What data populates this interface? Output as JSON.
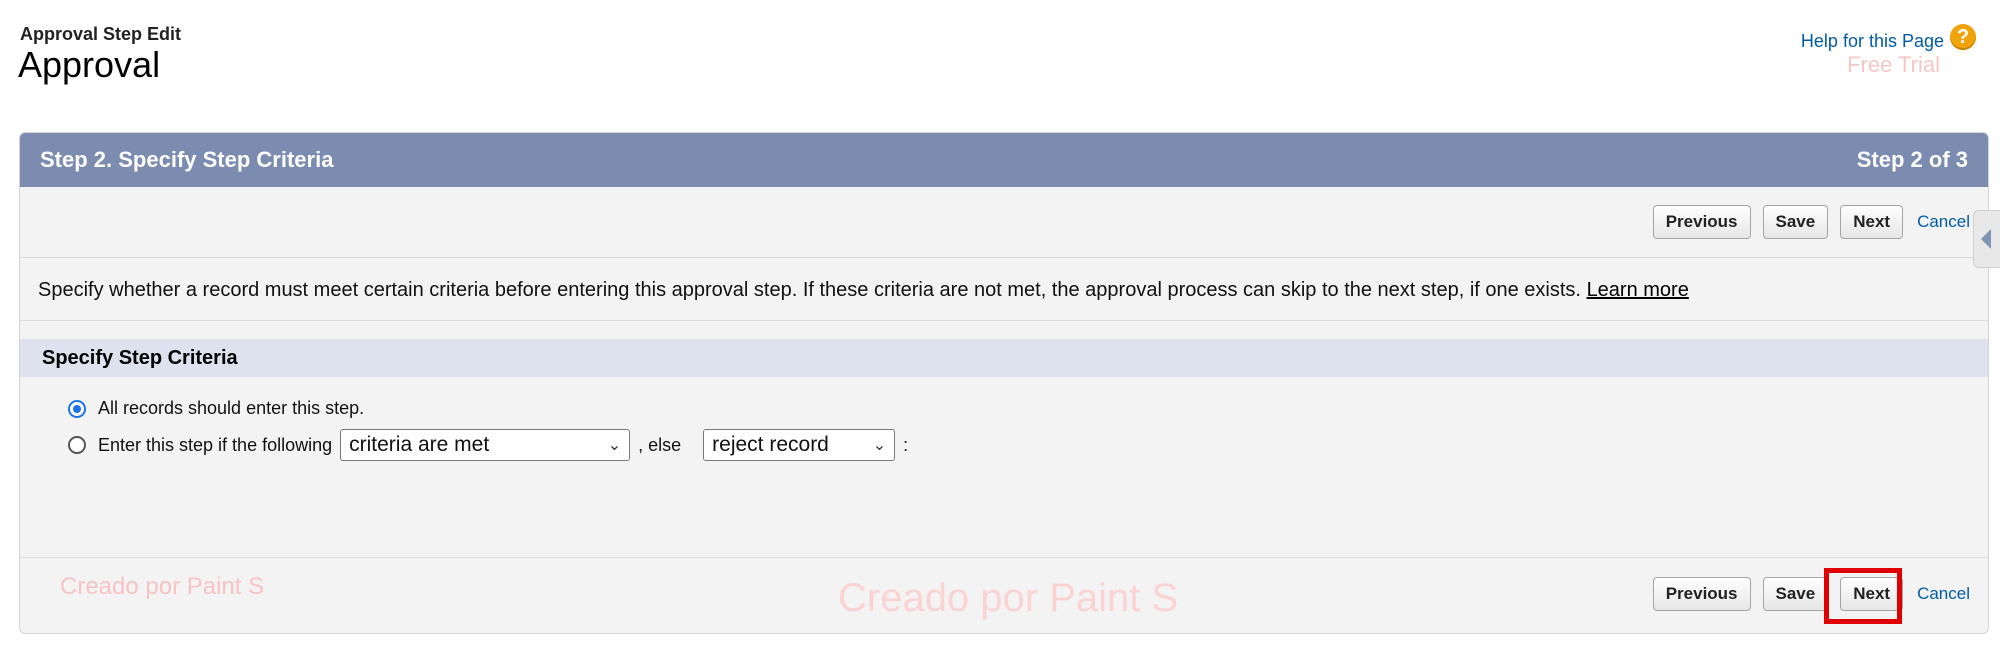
{
  "header": {
    "subtitle": "Approval Step Edit",
    "title": "Approval",
    "help_link": "Help for this Page",
    "help_icon": "question-circle-icon",
    "free_trial": "Free Trial"
  },
  "panel": {
    "header_left": "Step 2. Specify Step Criteria",
    "header_right": "Step 2 of 3",
    "buttons": {
      "previous": "Previous",
      "save": "Save",
      "next": "Next",
      "cancel": "Cancel"
    },
    "description": "Specify whether a record must meet certain criteria before entering this approval step. If these criteria are not met, the approval process can skip to the next step, if one exists.",
    "learn_more": "Learn more",
    "section_title": "Specify Step Criteria",
    "option_all": "All records should enter this step.",
    "option_criteria_prefix": "Enter this step if the following",
    "criteria_select": "criteria are met",
    "else_text": ", else",
    "else_select": "reject record",
    "colon": ":"
  },
  "watermarks": {
    "left": "Creado por Paint S",
    "center": "Creado por Paint S"
  },
  "colors": {
    "panel_header": "#7b8cb0",
    "section_header": "#dde2ee",
    "link": "#015ba7",
    "highlight": "#e00000"
  }
}
